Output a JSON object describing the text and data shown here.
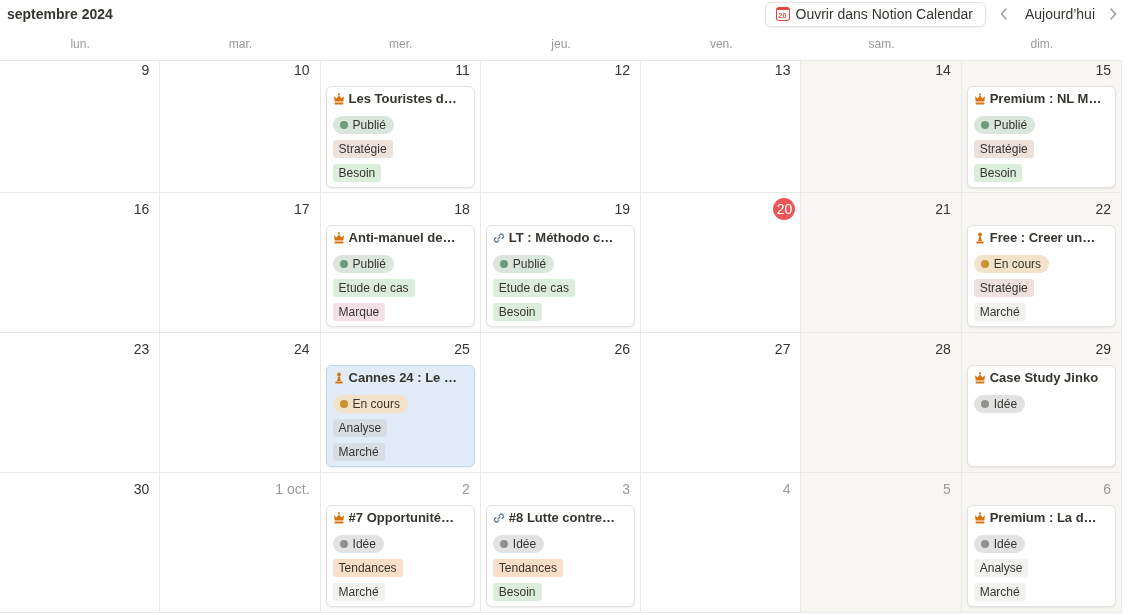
{
  "header": {
    "title": "septembre 2024",
    "open_button": {
      "label": "Ouvrir dans Notion Calendar",
      "icon_text": "20"
    },
    "today_button": "Aujourd’hui"
  },
  "weekdays": [
    "lun.",
    "mar.",
    "mer.",
    "jeu.",
    "ven.",
    "sam.",
    "dim."
  ],
  "weeks": [
    {
      "days": [
        {
          "date": "9",
          "muted": false,
          "today": false
        },
        {
          "date": "10",
          "muted": false,
          "today": false
        },
        {
          "date": "11",
          "muted": false,
          "today": false,
          "event": {
            "title": "Les Touristes d…",
            "kind": "crown",
            "selected": false,
            "status": {
              "label": "Publié",
              "color": "#6c9b7d"
            },
            "tags": [
              {
                "label": "Stratégie",
                "color": "#eee0da"
              },
              {
                "label": "Besoin",
                "color": "#dbeddb"
              }
            ]
          }
        },
        {
          "date": "12",
          "muted": false,
          "today": false
        },
        {
          "date": "13",
          "muted": false,
          "today": false
        },
        {
          "date": "14",
          "muted": false,
          "today": false
        },
        {
          "date": "15",
          "muted": false,
          "today": false,
          "event": {
            "title": "Premium : NL M…",
            "kind": "crown",
            "selected": false,
            "status": {
              "label": "Publié",
              "color": "#6c9b7d"
            },
            "tags": [
              {
                "label": "Stratégie",
                "color": "#eee0da"
              },
              {
                "label": "Besoin",
                "color": "#dbeddb"
              }
            ]
          }
        }
      ]
    },
    {
      "days": [
        {
          "date": "16",
          "muted": false,
          "today": false
        },
        {
          "date": "17",
          "muted": false,
          "today": false
        },
        {
          "date": "18",
          "muted": false,
          "today": false,
          "event": {
            "title": "Anti-manuel de…",
            "kind": "crown",
            "selected": false,
            "status": {
              "label": "Publié",
              "color": "#6c9b7d"
            },
            "tags": [
              {
                "label": "Etude de cas",
                "color": "#dbeddb"
              },
              {
                "label": "Marque",
                "color": "#f5e0e9"
              }
            ]
          }
        },
        {
          "date": "19",
          "muted": false,
          "today": false,
          "event": {
            "title": "LT : Méthodo c…",
            "kind": "link",
            "selected": false,
            "status": {
              "label": "Publié",
              "color": "#6c9b7d"
            },
            "tags": [
              {
                "label": "Etude de cas",
                "color": "#dbeddb"
              },
              {
                "label": "Besoin",
                "color": "#dbeddb"
              }
            ]
          }
        },
        {
          "date": "20",
          "muted": false,
          "today": true
        },
        {
          "date": "21",
          "muted": false,
          "today": false
        },
        {
          "date": "22",
          "muted": false,
          "today": false,
          "event": {
            "title": "Free : Creer un…",
            "kind": "pawn",
            "selected": false,
            "status": {
              "label": "En cours",
              "color": "#cb912f"
            },
            "tags": [
              {
                "label": "Stratégie",
                "color": "#eee0da"
              },
              {
                "label": "Marché",
                "color": "#f1f1ef"
              }
            ]
          }
        }
      ]
    },
    {
      "days": [
        {
          "date": "23",
          "muted": false,
          "today": false
        },
        {
          "date": "24",
          "muted": false,
          "today": false
        },
        {
          "date": "25",
          "muted": false,
          "today": false,
          "event": {
            "title": "Cannes 24 : Le …",
            "kind": "pawn",
            "selected": true,
            "status": {
              "label": "En cours",
              "color": "#cb912f"
            },
            "tags": [
              {
                "label": "Analyse",
                "color": "#d8dde3"
              },
              {
                "label": "Marché",
                "color": "#d8dde3"
              }
            ]
          }
        },
        {
          "date": "26",
          "muted": false,
          "today": false
        },
        {
          "date": "27",
          "muted": false,
          "today": false
        },
        {
          "date": "28",
          "muted": false,
          "today": false
        },
        {
          "date": "29",
          "muted": false,
          "today": false,
          "event": {
            "title": "Case Study Jinko",
            "kind": "crown",
            "selected": false,
            "status": {
              "label": "Idée",
              "color": "#91918e"
            }
          }
        }
      ]
    },
    {
      "days": [
        {
          "date": "30",
          "muted": false,
          "today": false
        },
        {
          "date": "1 oct.",
          "muted": true,
          "today": false
        },
        {
          "date": "2",
          "muted": true,
          "today": false,
          "event": {
            "title": "#7 Opportunité…",
            "kind": "crown",
            "selected": false,
            "status": {
              "label": "Idée",
              "color": "#91918e"
            },
            "tags": [
              {
                "label": "Tendances",
                "color": "#fadec9"
              },
              {
                "label": "Marché",
                "color": "#f1f1ef"
              }
            ]
          }
        },
        {
          "date": "3",
          "muted": true,
          "today": false,
          "event": {
            "title": "#8 Lutte contre…",
            "kind": "link",
            "selected": false,
            "status": {
              "label": "Idée",
              "color": "#91918e"
            },
            "tags": [
              {
                "label": "Tendances",
                "color": "#fadec9"
              },
              {
                "label": "Besoin",
                "color": "#dbeddb"
              }
            ]
          }
        },
        {
          "date": "4",
          "muted": true,
          "today": false
        },
        {
          "date": "5",
          "muted": true,
          "today": false
        },
        {
          "date": "6",
          "muted": true,
          "today": false,
          "event": {
            "title": "Premium : La d…",
            "kind": "crown",
            "selected": false,
            "status": {
              "label": "Idée",
              "color": "#91918e"
            },
            "tags": [
              {
                "label": "Analyse",
                "color": "#f1f1ef"
              },
              {
                "label": "Marché",
                "color": "#f1f1ef"
              }
            ]
          }
        }
      ]
    }
  ]
}
